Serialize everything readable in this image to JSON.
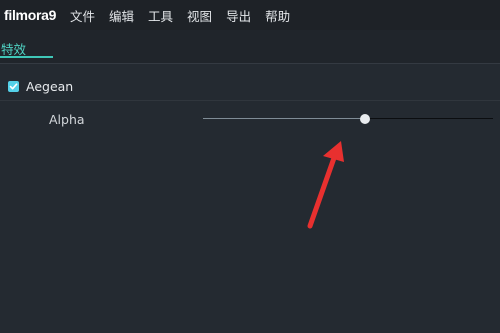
{
  "app": {
    "logo": "filmora9"
  },
  "menu": {
    "items": [
      {
        "label": "文件"
      },
      {
        "label": "编辑"
      },
      {
        "label": "工具"
      },
      {
        "label": "视图"
      },
      {
        "label": "导出"
      },
      {
        "label": "帮助"
      }
    ]
  },
  "tab": {
    "label": "特效"
  },
  "effect": {
    "name": "Aegean",
    "checked": true
  },
  "parameter": {
    "label": "Alpha",
    "value_fraction": 0.56
  },
  "colors": {
    "accent": "#3fc7b8",
    "checkbox": "#54d0e8",
    "annotation_arrow": "#e8302f"
  },
  "annotation": {
    "icon": "red-arrow-icon"
  }
}
